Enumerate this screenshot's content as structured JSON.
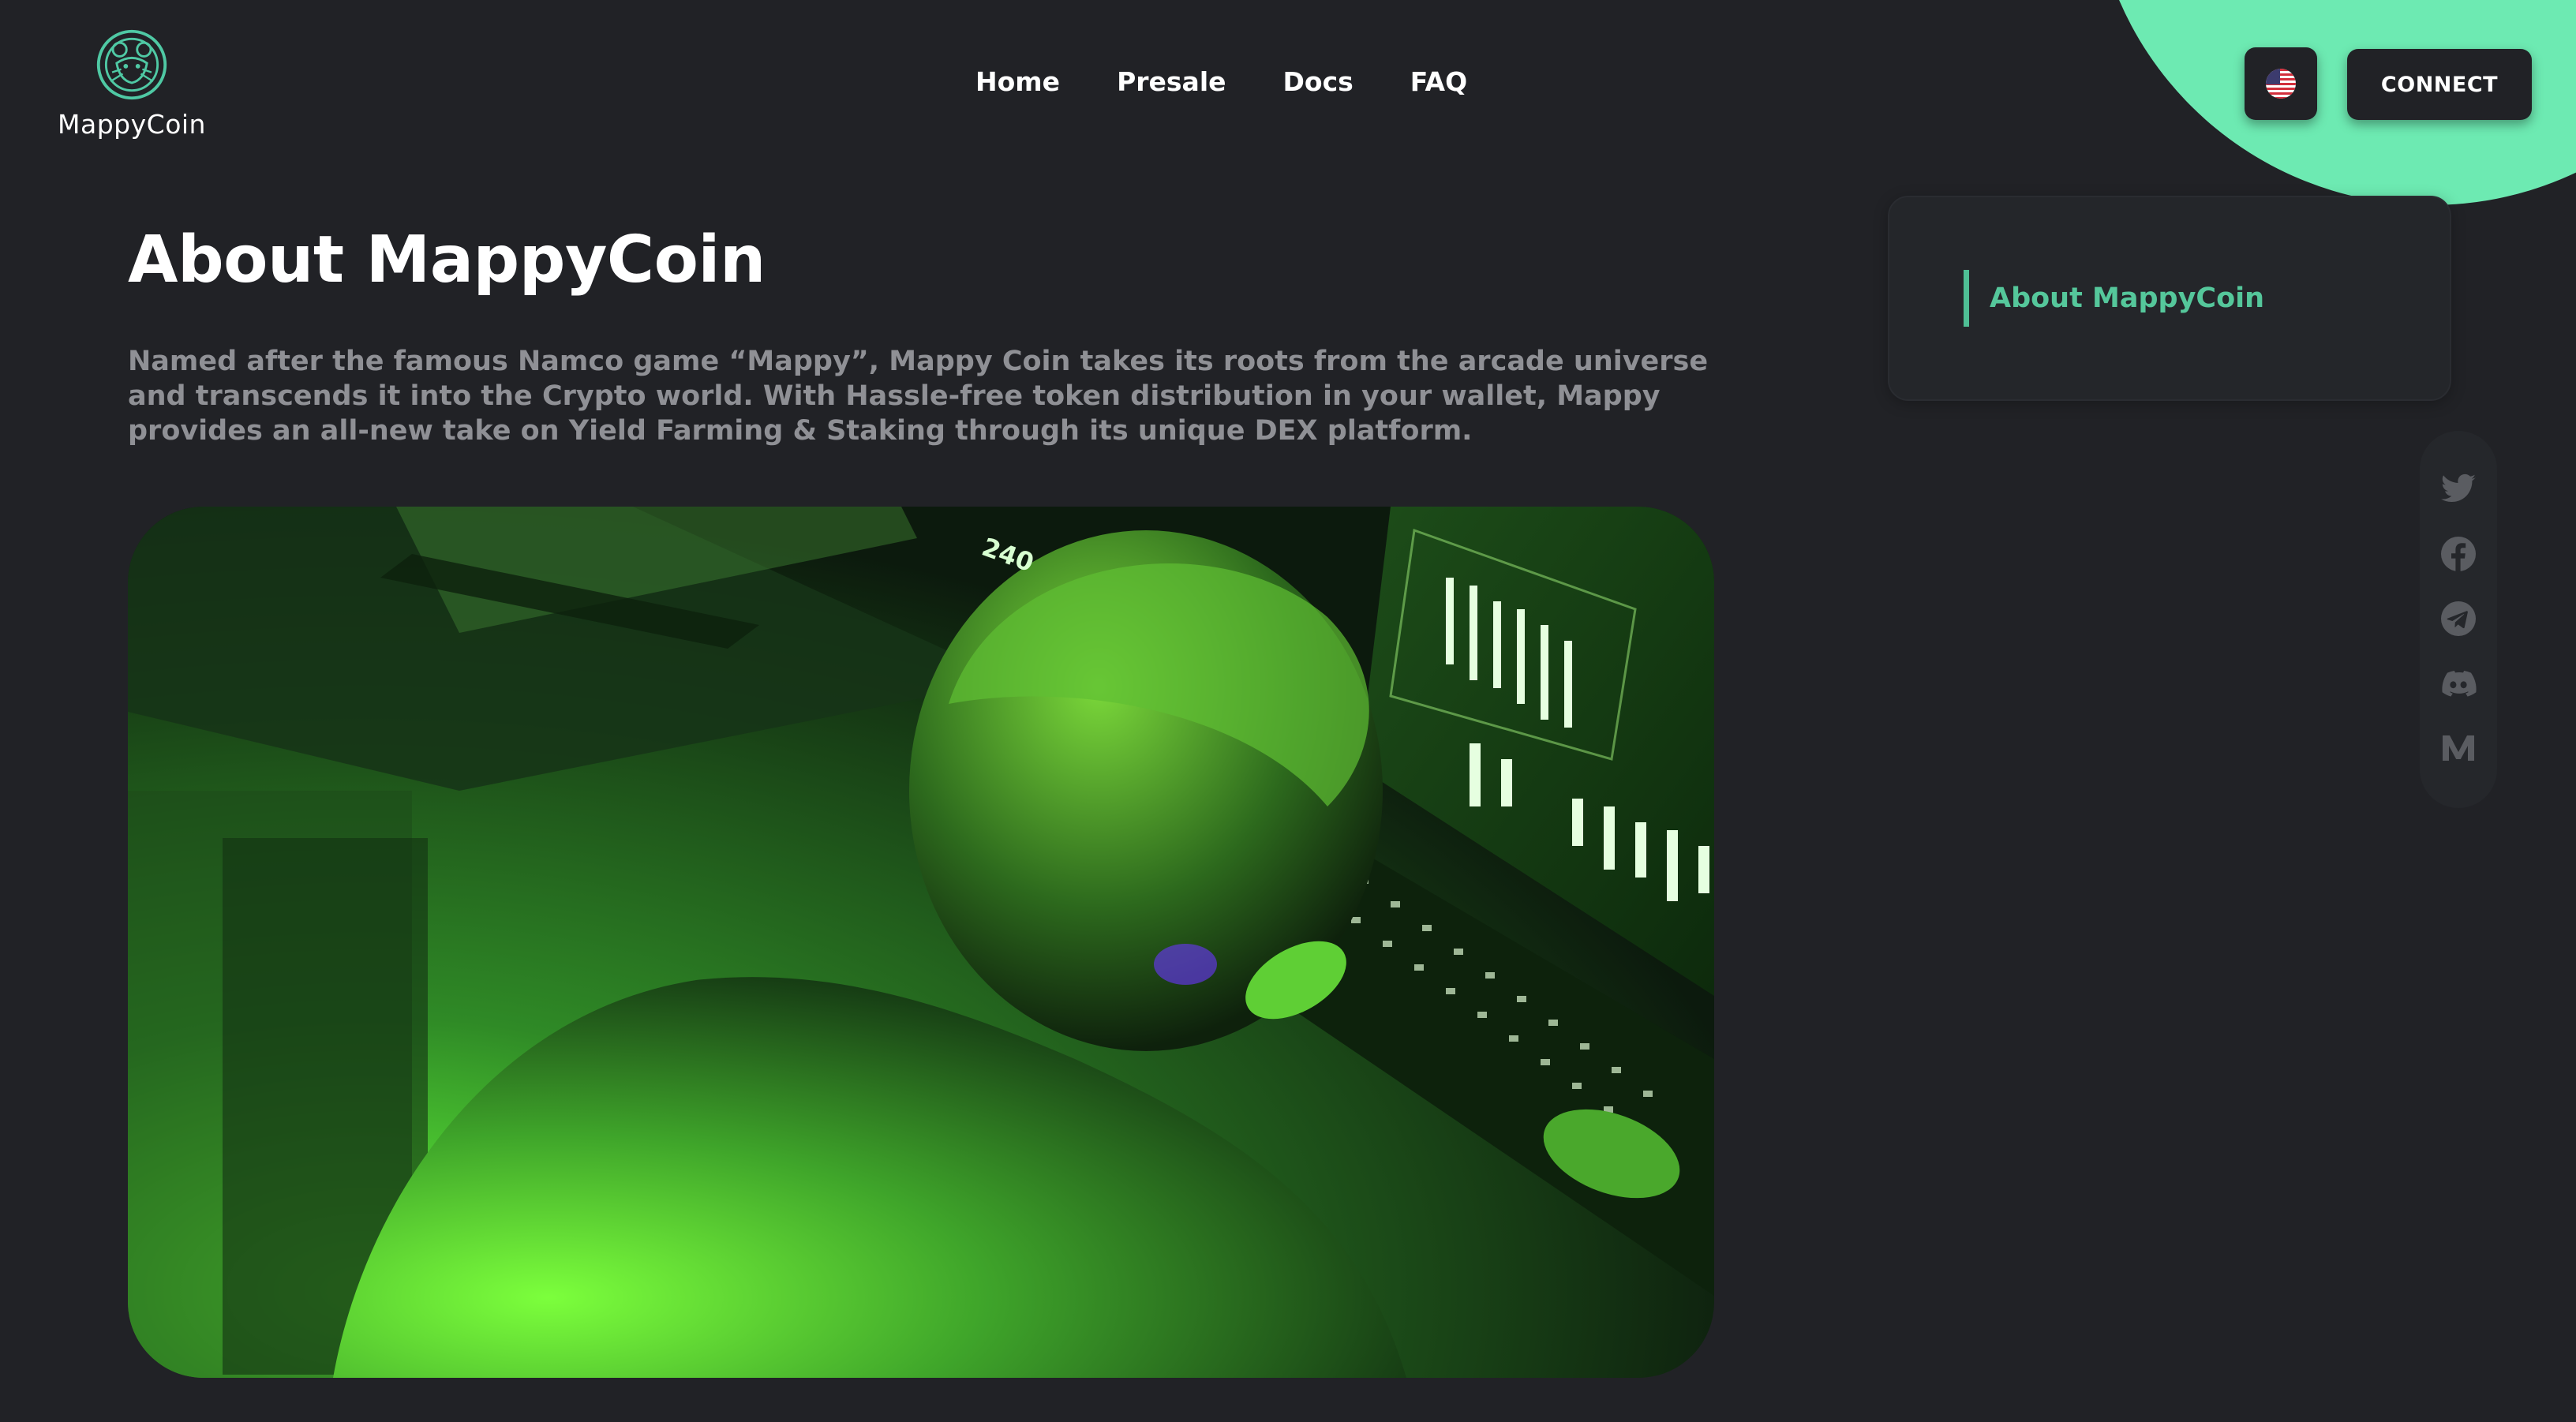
{
  "brand": {
    "name": "MappyCoin"
  },
  "nav": {
    "items": [
      {
        "label": "Home"
      },
      {
        "label": "Presale"
      },
      {
        "label": "Docs"
      },
      {
        "label": "FAQ"
      }
    ]
  },
  "header": {
    "language_icon": "us-flag-icon",
    "connect_label": "CONNECT"
  },
  "main": {
    "title": "About MappyCoin",
    "description": "Named after the famous Namco game “Mappy”, Mappy Coin takes its roots from the arcade universe and transcends it into the Crypto world. With Hassle-free token distribution in your wallet, Mappy provides an all-new take on Yield Farming & Staking through its unique DEX platform."
  },
  "toc": {
    "items": [
      {
        "label": "About MappyCoin"
      }
    ]
  },
  "social": {
    "icons": [
      "twitter-icon",
      "facebook-icon",
      "telegram-icon",
      "discord-icon",
      "medium-icon"
    ]
  },
  "colors": {
    "background": "#212226",
    "accent": "#6deab2",
    "toc_active": "#55c79b",
    "muted_text": "#8f9095"
  }
}
